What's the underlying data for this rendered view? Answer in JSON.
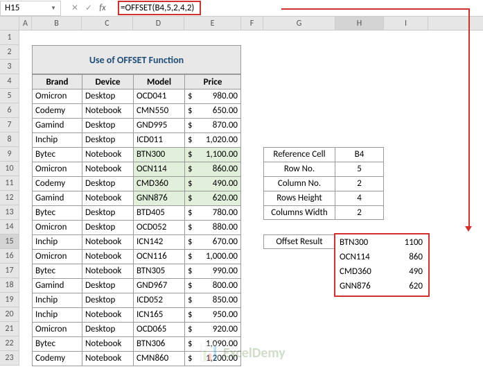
{
  "nameBox": "H15",
  "formula": "=OFFSET(B4,5,2,4,2)",
  "columns": [
    "A",
    "B",
    "C",
    "D",
    "E",
    "F",
    "G",
    "H",
    "I"
  ],
  "rows": [
    "1",
    "2",
    "3",
    "4",
    "5",
    "6",
    "7",
    "8",
    "9",
    "10",
    "11",
    "12",
    "13",
    "14",
    "15",
    "16",
    "17",
    "18",
    "19",
    "20",
    "21",
    "22",
    "23"
  ],
  "title": "Use of OFFSET Function",
  "headers": {
    "brand": "Brand",
    "device": "Device",
    "model": "Model",
    "price": "Price"
  },
  "currency": "$",
  "data": [
    {
      "brand": "Omicron",
      "device": "Desktop",
      "model": "OCD041",
      "price": "980.00",
      "hl": false
    },
    {
      "brand": "Codemy",
      "device": "Notebook",
      "model": "CMN550",
      "price": "650.00",
      "hl": false
    },
    {
      "brand": "Gamind",
      "device": "Desktop",
      "model": "GND995",
      "price": "870.00",
      "hl": false
    },
    {
      "brand": "Inchip",
      "device": "Desktop",
      "model": "ICD011",
      "price": "1,020.00",
      "hl": false
    },
    {
      "brand": "Bytec",
      "device": "Notebook",
      "model": "BTN300",
      "price": "1,100.00",
      "hl": true
    },
    {
      "brand": "Omicron",
      "device": "Notebook",
      "model": "OCN114",
      "price": "860.00",
      "hl": true
    },
    {
      "brand": "Codemy",
      "device": "Desktop",
      "model": "CMD360",
      "price": "490.00",
      "hl": true
    },
    {
      "brand": "Gamind",
      "device": "Notebook",
      "model": "GNN876",
      "price": "620.00",
      "hl": true
    },
    {
      "brand": "Bytec",
      "device": "Desktop",
      "model": "BTD405",
      "price": "780.00",
      "hl": false
    },
    {
      "brand": "Omicron",
      "device": "Desktop",
      "model": "OCD052",
      "price": "880.00",
      "hl": false
    },
    {
      "brand": "Inchip",
      "device": "Notebook",
      "model": "ICN142",
      "price": "670.00",
      "hl": false
    },
    {
      "brand": "Omicron",
      "device": "Notebook",
      "model": "OCN116",
      "price": "1,000.00",
      "hl": false
    },
    {
      "brand": "Bytec",
      "device": "Notebook",
      "model": "BTN305",
      "price": "990.00",
      "hl": false
    },
    {
      "brand": "Gamind",
      "device": "Desktop",
      "model": "GND967",
      "price": "800.00",
      "hl": false
    },
    {
      "brand": "Inchip",
      "device": "Desktop",
      "model": "ICD052",
      "price": "850.00",
      "hl": false
    },
    {
      "brand": "Inchip",
      "device": "Notebook",
      "model": "ICN165",
      "price": "950.00",
      "hl": false
    },
    {
      "brand": "Omicron",
      "device": "Desktop",
      "model": "OCD065",
      "price": "920.00",
      "hl": false
    },
    {
      "brand": "Bytec",
      "device": "Notebook",
      "model": "BTN306",
      "price": "1,090.00",
      "hl": false
    },
    {
      "brand": "Codemy",
      "device": "Notebook",
      "model": "CMN860",
      "price": "1,200.00",
      "hl": false
    }
  ],
  "params": [
    {
      "label": "Reference Cell",
      "val": "B4"
    },
    {
      "label": "Row No.",
      "val": "5"
    },
    {
      "label": "Column No.",
      "val": "2"
    },
    {
      "label": "Rows Height",
      "val": "4"
    },
    {
      "label": "Columns Width",
      "val": "2"
    }
  ],
  "resultLabel": "Offset Result",
  "results": [
    {
      "model": "BTN300",
      "val": "1100"
    },
    {
      "model": "OCN114",
      "val": "860"
    },
    {
      "model": "CMD360",
      "val": "490"
    },
    {
      "model": "GNN876",
      "val": "620"
    }
  ],
  "watermark": "ExcelDemy",
  "fx": "fx"
}
